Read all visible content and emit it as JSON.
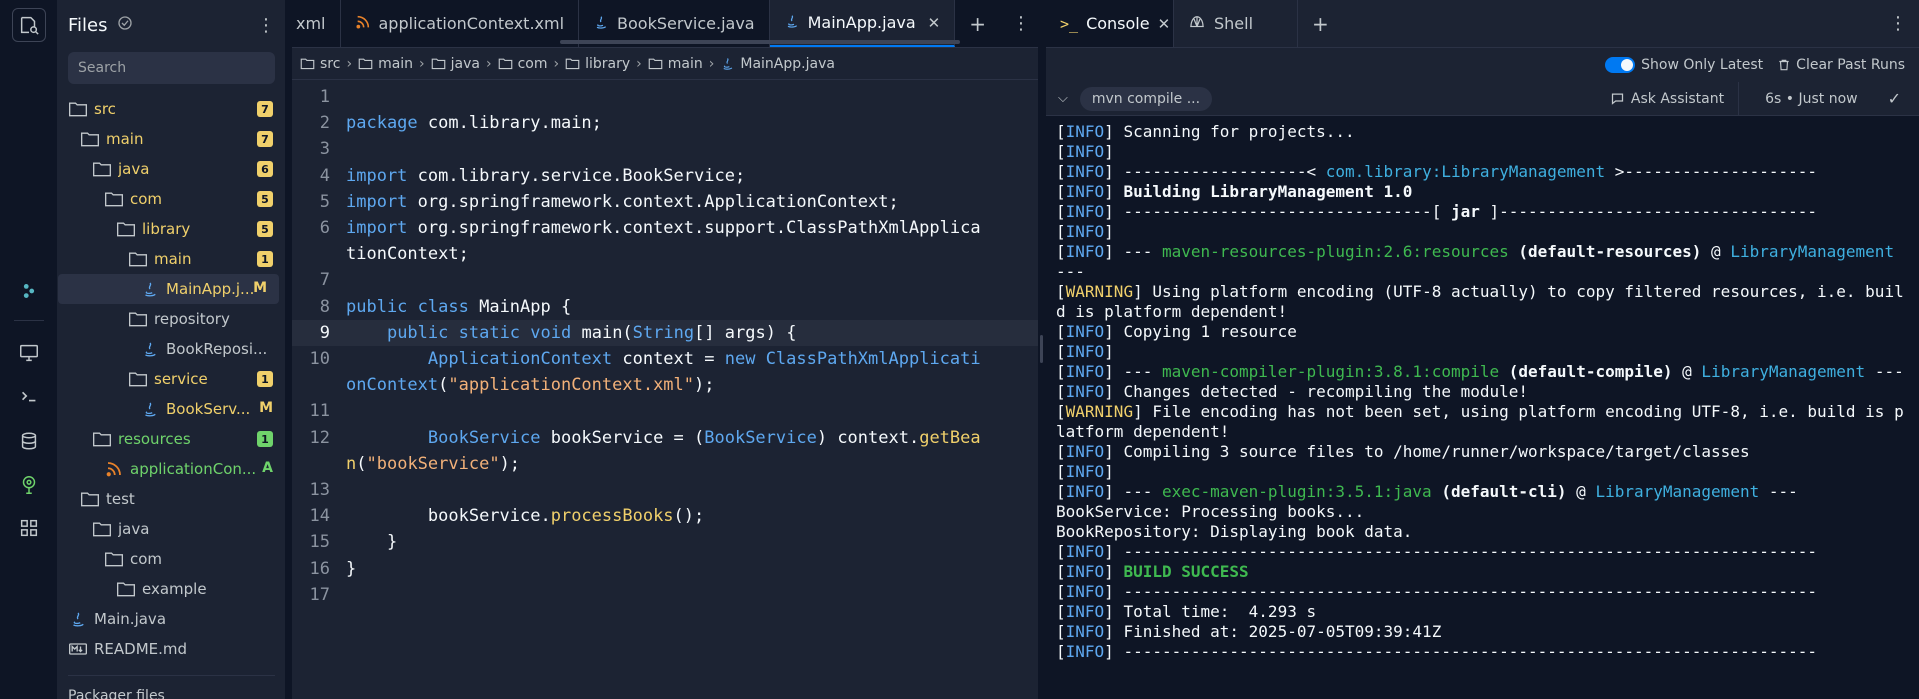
{
  "files": {
    "title": "Files",
    "search_placeholder": "Search",
    "tree": [
      {
        "label": "src",
        "badge": "7",
        "type": "folder",
        "color": "yellow"
      },
      {
        "label": "main",
        "badge": "7",
        "type": "folder",
        "color": "yellow"
      },
      {
        "label": "java",
        "badge": "6",
        "type": "folder",
        "color": "yellow"
      },
      {
        "label": "com",
        "badge": "5",
        "type": "folder",
        "color": "yellow"
      },
      {
        "label": "library",
        "badge": "5",
        "type": "folder",
        "color": "yellow"
      },
      {
        "label": "main",
        "badge": "1",
        "type": "folder",
        "color": "yellow"
      },
      {
        "label": "MainApp.j...",
        "status": "M",
        "type": "java",
        "color": "yellow"
      },
      {
        "label": "repository",
        "type": "folder"
      },
      {
        "label": "BookReposi...",
        "type": "java"
      },
      {
        "label": "service",
        "badge": "1",
        "type": "folder",
        "color": "yellow"
      },
      {
        "label": "BookServ...",
        "status": "M",
        "type": "java",
        "color": "yellow"
      },
      {
        "label": "resources",
        "badge": "1",
        "type": "folder",
        "color": "green"
      },
      {
        "label": "applicationCon...",
        "status": "A",
        "type": "xml",
        "color": "green"
      },
      {
        "label": "test",
        "type": "folder"
      },
      {
        "label": "java",
        "type": "folder"
      },
      {
        "label": "com",
        "type": "folder"
      },
      {
        "label": "example",
        "type": "folder"
      },
      {
        "label": "Main.java",
        "type": "java"
      },
      {
        "label": "README.md",
        "type": "md"
      }
    ],
    "packager": "Packager files"
  },
  "editor": {
    "tabs": [
      {
        "label": "xml"
      },
      {
        "label": "applicationContext.xml"
      },
      {
        "label": "BookService.java"
      },
      {
        "label": "MainApp.java",
        "close": "✕"
      }
    ],
    "breadcrumb": [
      "src",
      "main",
      "java",
      "com",
      "library",
      "main",
      "MainApp.java"
    ],
    "lines": [
      {
        "n": "1",
        "t": ""
      },
      {
        "n": "2",
        "t": "package com.library.main;"
      },
      {
        "n": "3",
        "t": ""
      },
      {
        "n": "4",
        "t": "import com.library.service.BookService;"
      },
      {
        "n": "5",
        "t": "import org.springframework.context.ApplicationContext;"
      },
      {
        "n": "6",
        "t": "import org.springframework.context.support.ClassPathXmlApplicationContext;"
      },
      {
        "n": "7",
        "t": ""
      },
      {
        "n": "8",
        "t": "public class MainApp {"
      },
      {
        "n": "9",
        "t": "    public static void main(String[] args) {"
      },
      {
        "n": "10",
        "t": "        ApplicationContext context = new ClassPathXmlApplicationContext(\"applicationContext.xml\");"
      },
      {
        "n": "11",
        "t": ""
      },
      {
        "n": "12",
        "t": "        BookService bookService = (BookService) context.getBean(\"bookService\");"
      },
      {
        "n": "13",
        "t": ""
      },
      {
        "n": "14",
        "t": "        bookService.processBooks();"
      },
      {
        "n": "15",
        "t": "    }"
      },
      {
        "n": "16",
        "t": "}"
      },
      {
        "n": "17",
        "t": ""
      }
    ]
  },
  "console": {
    "tabs": [
      {
        "label": "Console",
        "close": "✕"
      },
      {
        "label": "Shell"
      }
    ],
    "show_only_latest": "Show Only Latest",
    "clear_past_runs": "Clear Past Runs",
    "command": "mvn compile ...",
    "ask_assistant": "Ask Assistant",
    "run_time": "6s • Just now",
    "log": [
      {
        "tag": "INFO",
        "parts": [
          {
            "t": " Scanning for projects..."
          }
        ]
      },
      {
        "tag": "INFO",
        "parts": []
      },
      {
        "tag": "INFO",
        "parts": [
          {
            "t": " -------------------< "
          },
          {
            "t": "com.library:LibraryManagement",
            "c": "b"
          },
          {
            "t": " >--------------------"
          }
        ]
      },
      {
        "tag": "INFO",
        "parts": [
          {
            "t": " Building LibraryManagement 1.0",
            "c": "bold"
          }
        ]
      },
      {
        "tag": "INFO",
        "parts": [
          {
            "t": " --------------------------------[ "
          },
          {
            "t": "jar",
            "c": "bold"
          },
          {
            "t": " ]---------------------------------"
          }
        ]
      },
      {
        "tag": "INFO",
        "parts": []
      },
      {
        "tag": "INFO",
        "parts": [
          {
            "t": " --- "
          },
          {
            "t": "maven-resources-plugin:2.6:resources",
            "c": "g"
          },
          {
            "t": " (default-resources)",
            "c": "bold"
          },
          {
            "t": " @ "
          },
          {
            "t": "LibraryManagement",
            "c": "b"
          },
          {
            "t": " ---"
          }
        ]
      },
      {
        "tag": "WARNING",
        "parts": [
          {
            "t": " Using platform encoding (UTF-8 actually) to copy filtered resources, i.e. build is platform dependent!"
          }
        ]
      },
      {
        "tag": "INFO",
        "parts": [
          {
            "t": " Copying 1 resource"
          }
        ]
      },
      {
        "tag": "INFO",
        "parts": []
      },
      {
        "tag": "INFO",
        "parts": [
          {
            "t": " --- "
          },
          {
            "t": "maven-compiler-plugin:3.8.1:compile",
            "c": "g"
          },
          {
            "t": " (default-compile)",
            "c": "bold"
          },
          {
            "t": " @ "
          },
          {
            "t": "LibraryManagement",
            "c": "b"
          },
          {
            "t": " ---"
          }
        ]
      },
      {
        "tag": "INFO",
        "parts": [
          {
            "t": " Changes detected - recompiling the module!"
          }
        ]
      },
      {
        "tag": "WARNING",
        "parts": [
          {
            "t": " File encoding has not been set, using platform encoding UTF-8, i.e. build is platform dependent!"
          }
        ]
      },
      {
        "tag": "INFO",
        "parts": [
          {
            "t": " Compiling 3 source files to /home/runner/workspace/target/classes"
          }
        ]
      },
      {
        "tag": "INFO",
        "parts": []
      },
      {
        "tag": "INFO",
        "parts": [
          {
            "t": " --- "
          },
          {
            "t": "exec-maven-plugin:3.5.1:java",
            "c": "g"
          },
          {
            "t": " (default-cli)",
            "c": "bold"
          },
          {
            "t": " @ "
          },
          {
            "t": "LibraryManagement",
            "c": "b"
          },
          {
            "t": " ---"
          }
        ]
      },
      {
        "tag": "",
        "parts": [
          {
            "t": "BookService: Processing books..."
          }
        ]
      },
      {
        "tag": "",
        "parts": [
          {
            "t": "BookRepository: Displaying book data."
          }
        ]
      },
      {
        "tag": "INFO",
        "parts": [
          {
            "t": " ------------------------------------------------------------------------"
          }
        ]
      },
      {
        "tag": "INFO",
        "parts": [
          {
            "t": " BUILD SUCCESS",
            "c": "bold-g"
          }
        ]
      },
      {
        "tag": "INFO",
        "parts": [
          {
            "t": " ------------------------------------------------------------------------"
          }
        ]
      },
      {
        "tag": "INFO",
        "parts": [
          {
            "t": " Total time:  4.293 s"
          }
        ]
      },
      {
        "tag": "INFO",
        "parts": [
          {
            "t": " Finished at: 2025-07-05T09:39:41Z"
          }
        ]
      },
      {
        "tag": "INFO",
        "parts": [
          {
            "t": " ------------------------------------------------------------------------"
          }
        ]
      }
    ]
  },
  "colors": {
    "accent": "#0079f2",
    "modified": "#f0d06b",
    "added": "#6fd36b",
    "keyword": "#5ea8f0",
    "string": "#f2b179",
    "success": "#3fb950"
  }
}
